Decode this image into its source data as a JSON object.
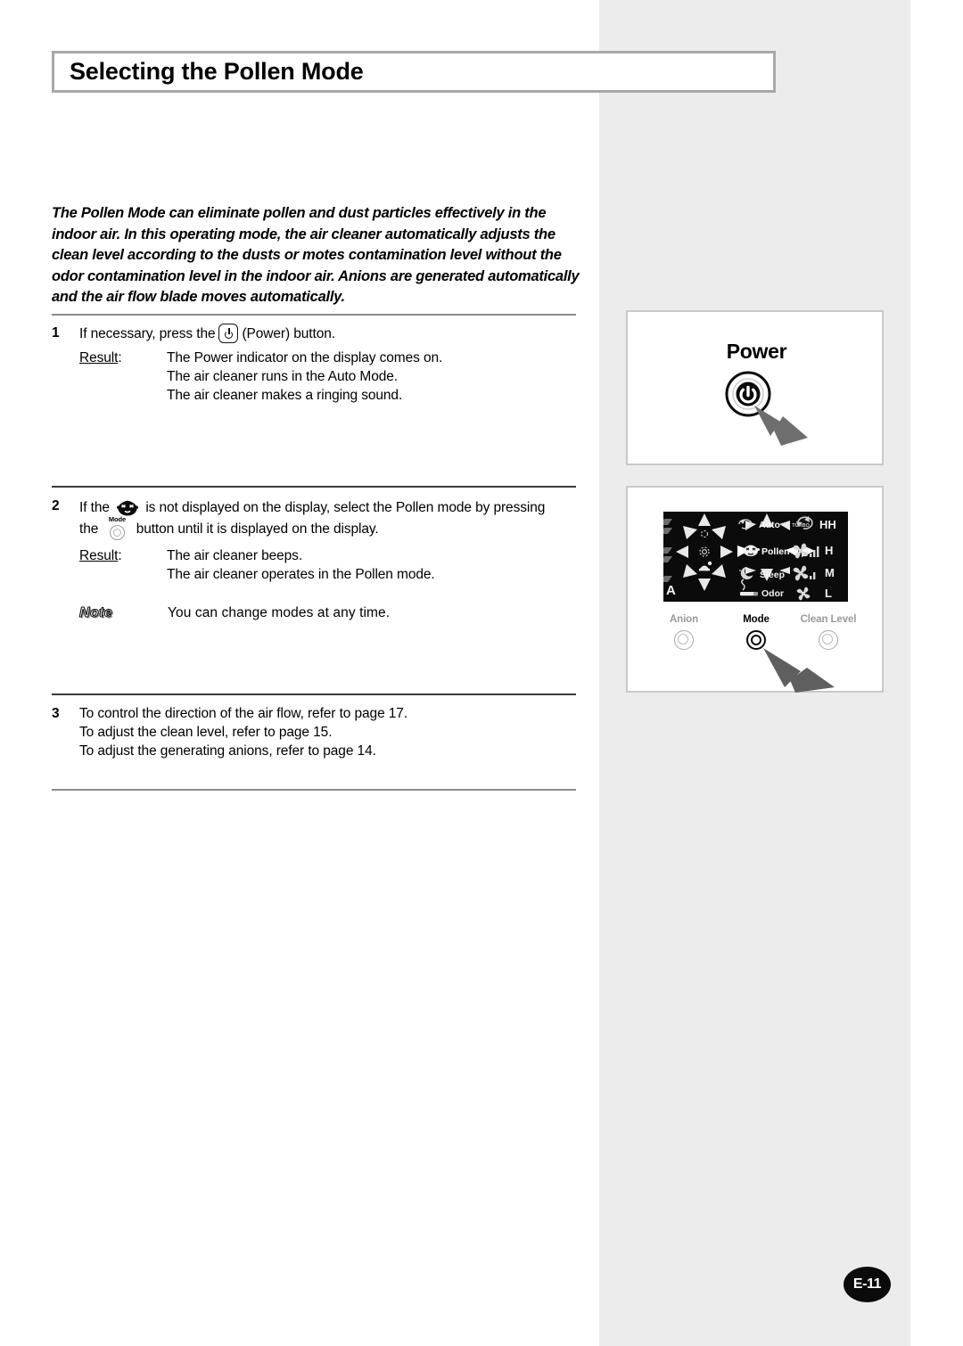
{
  "page": {
    "title": "Selecting the Pollen Mode",
    "page_number": "E-11"
  },
  "intro": "The Pollen Mode can eliminate pollen and dust particles effectively in the indoor air. In this operating mode, the air cleaner automatically adjusts the clean level according to the dusts or motes contamination level without the odor contamination level in the indoor air. Anions are generated automatically and the air flow blade moves automatically.",
  "steps": [
    {
      "number": "1",
      "text_before_icon": "If necessary, press the",
      "icon": "power-icon",
      "text_after_icon": "(Power) button.",
      "result_label": "Result",
      "result_label_colon": ":",
      "results": [
        "The Power indicator on the display comes on.",
        "The air cleaner runs in the Auto Mode.",
        "The air cleaner makes a ringing sound."
      ]
    },
    {
      "number": "2",
      "line1_before_icon": "If the",
      "line1_icon": "pollen-face-icon",
      "line1_after_icon": "is not displayed on the display, select the Pollen mode by pressing",
      "line2_before_icon": "the",
      "line2_icon": "mode-button-icon",
      "line2_icon_label": "Mode",
      "line2_after_icon": "button until it is displayed on the display.",
      "result_label": "Result",
      "result_label_colon": ":",
      "results": [
        "The air cleaner beeps.",
        "The air cleaner operates in the Pollen mode."
      ],
      "note_badge": "Note",
      "note_text": "You can change modes at any time."
    },
    {
      "number": "3",
      "lines": [
        "To control the direction of the air flow, refer to page 17.",
        "To adjust the clean level, refer to page 15.",
        "To adjust the generating anions, refer to page 14."
      ]
    }
  ],
  "illustrations": {
    "power": {
      "caption": "Power",
      "button_icon": "power-button-icon",
      "pointer": "hand-pointer-icon"
    },
    "control_panel": {
      "display": {
        "clean_level_indicator": "A",
        "mode_rows": [
          {
            "icon": "auto-icon",
            "label": "Auto"
          },
          {
            "icon": "pollen-face-icon",
            "label": "Pollen"
          },
          {
            "icon": "sleep-moon-icon",
            "label": "Sleep"
          },
          {
            "icon": "cigarette-odor-icon",
            "label": "Odor"
          }
        ],
        "fan_rows": [
          {
            "icon": "turbo-icon",
            "label": "HH"
          },
          {
            "icon": "fan-high-icon",
            "label": "H"
          },
          {
            "icon": "fan-mid-icon",
            "label": "M"
          },
          {
            "icon": "fan-low-icon",
            "label": "L"
          }
        ]
      },
      "buttons": [
        {
          "label": "Anion",
          "state": "inactive"
        },
        {
          "label": "Mode",
          "state": "active"
        },
        {
          "label": "Clean Level",
          "state": "inactive"
        }
      ],
      "pointer": "hand-pointer-icon"
    }
  },
  "colors": {
    "band": "#ececec",
    "title_border": "#a8a8a8",
    "divider": "#8c8c8c",
    "display_bg": "#0b0b0b",
    "pointer": "#6e6e6e"
  }
}
